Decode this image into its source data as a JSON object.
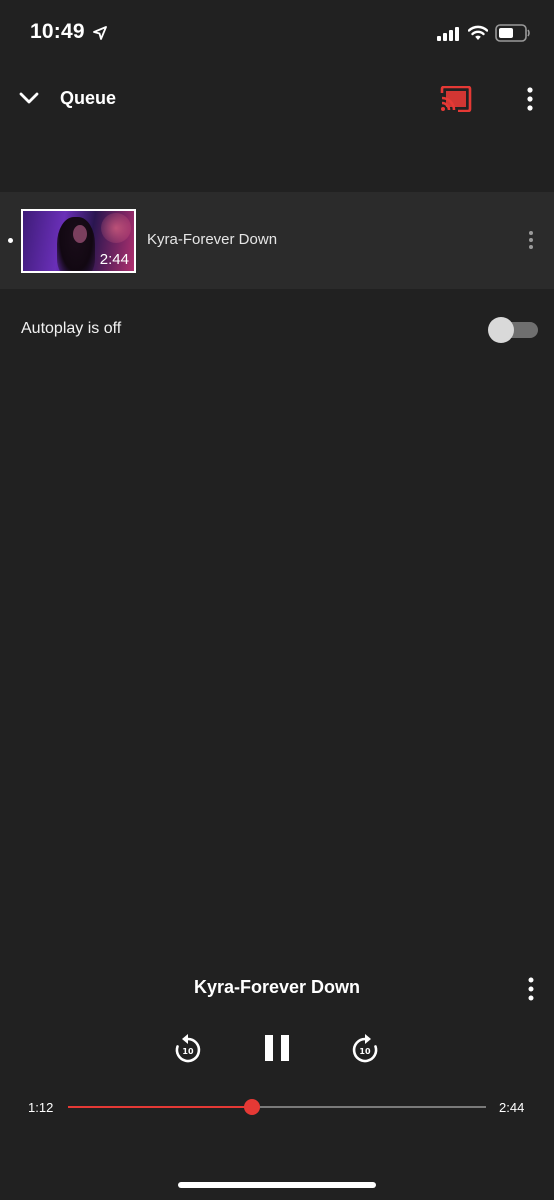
{
  "status_bar": {
    "time": "10:49",
    "icons": [
      "location-arrow-icon",
      "cellular-signal-icon",
      "wifi-icon",
      "battery-icon"
    ]
  },
  "header": {
    "title": "Queue",
    "icons": [
      "chevron-down-icon",
      "cast-icon",
      "more-vert-icon"
    ],
    "accent_color": "#e53935"
  },
  "queue": {
    "items": [
      {
        "title": "Kyra-Forever Down",
        "duration": "2:44",
        "now_playing": true
      }
    ]
  },
  "autoplay": {
    "label": "Autoplay is off",
    "enabled": false
  },
  "player": {
    "title": "Kyra-Forever Down",
    "elapsed": "1:12",
    "total": "2:44",
    "progress_fraction": 0.44,
    "rewind_seconds": "10",
    "forward_seconds": "10",
    "progress_color": "#e53935"
  }
}
